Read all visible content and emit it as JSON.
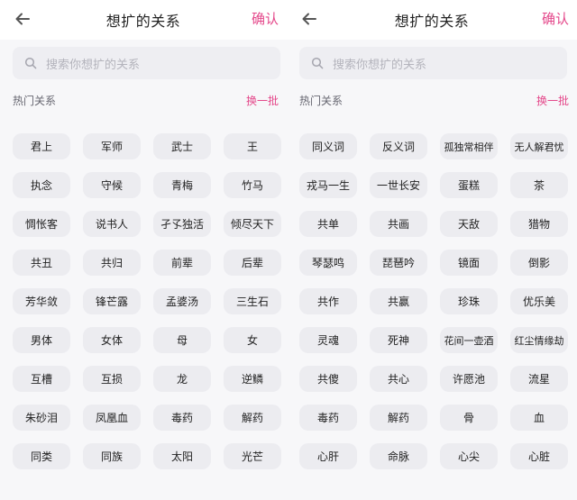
{
  "panels": [
    {
      "title": "想扩的关系",
      "confirm_label": "确认",
      "search": {
        "placeholder": "搜索你想扩的关系"
      },
      "section_title": "热门关系",
      "refresh_label": "换一批",
      "tags": [
        "君上",
        "军师",
        "武士",
        "王",
        "执念",
        "守候",
        "青梅",
        "竹马",
        "惆怅客",
        "说书人",
        "孑孓独活",
        "倾尽天下",
        "共丑",
        "共归",
        "前辈",
        "后辈",
        "芳华敛",
        "锋芒露",
        "孟婆汤",
        "三生石",
        "男体",
        "女体",
        "母",
        "女",
        "互槽",
        "互损",
        "龙",
        "逆鳞",
        "朱砂泪",
        "凤凰血",
        "毒药",
        "解药",
        "同类",
        "同族",
        "太阳",
        "光芒"
      ]
    },
    {
      "title": "想扩的关系",
      "confirm_label": "确认",
      "search": {
        "placeholder": "搜索你想扩的关系"
      },
      "section_title": "热门关系",
      "refresh_label": "换一批",
      "tags": [
        "同义词",
        "反义词",
        "孤独常相伴",
        "无人解君忧",
        "戎马一生",
        "一世长安",
        "蛋糕",
        "茶",
        "共单",
        "共画",
        "天敌",
        "猎物",
        "琴瑟鸣",
        "琵琶吟",
        "镜面",
        "倒影",
        "共作",
        "共赢",
        "珍珠",
        "优乐美",
        "灵魂",
        "死神",
        "花间一壶酒",
        "红尘情缘劫",
        "共傻",
        "共心",
        "许愿池",
        "流星",
        "毒药",
        "解药",
        "骨",
        "血",
        "心肝",
        "命脉",
        "心尖",
        "心脏"
      ]
    }
  ],
  "colors": {
    "accent": "#e4478a",
    "chip_bg": "#ececf0",
    "search_bg": "#eeeef2",
    "page_bg": "#f7f7f9"
  },
  "icons": {
    "back": "back-arrow-icon",
    "search": "search-icon"
  }
}
